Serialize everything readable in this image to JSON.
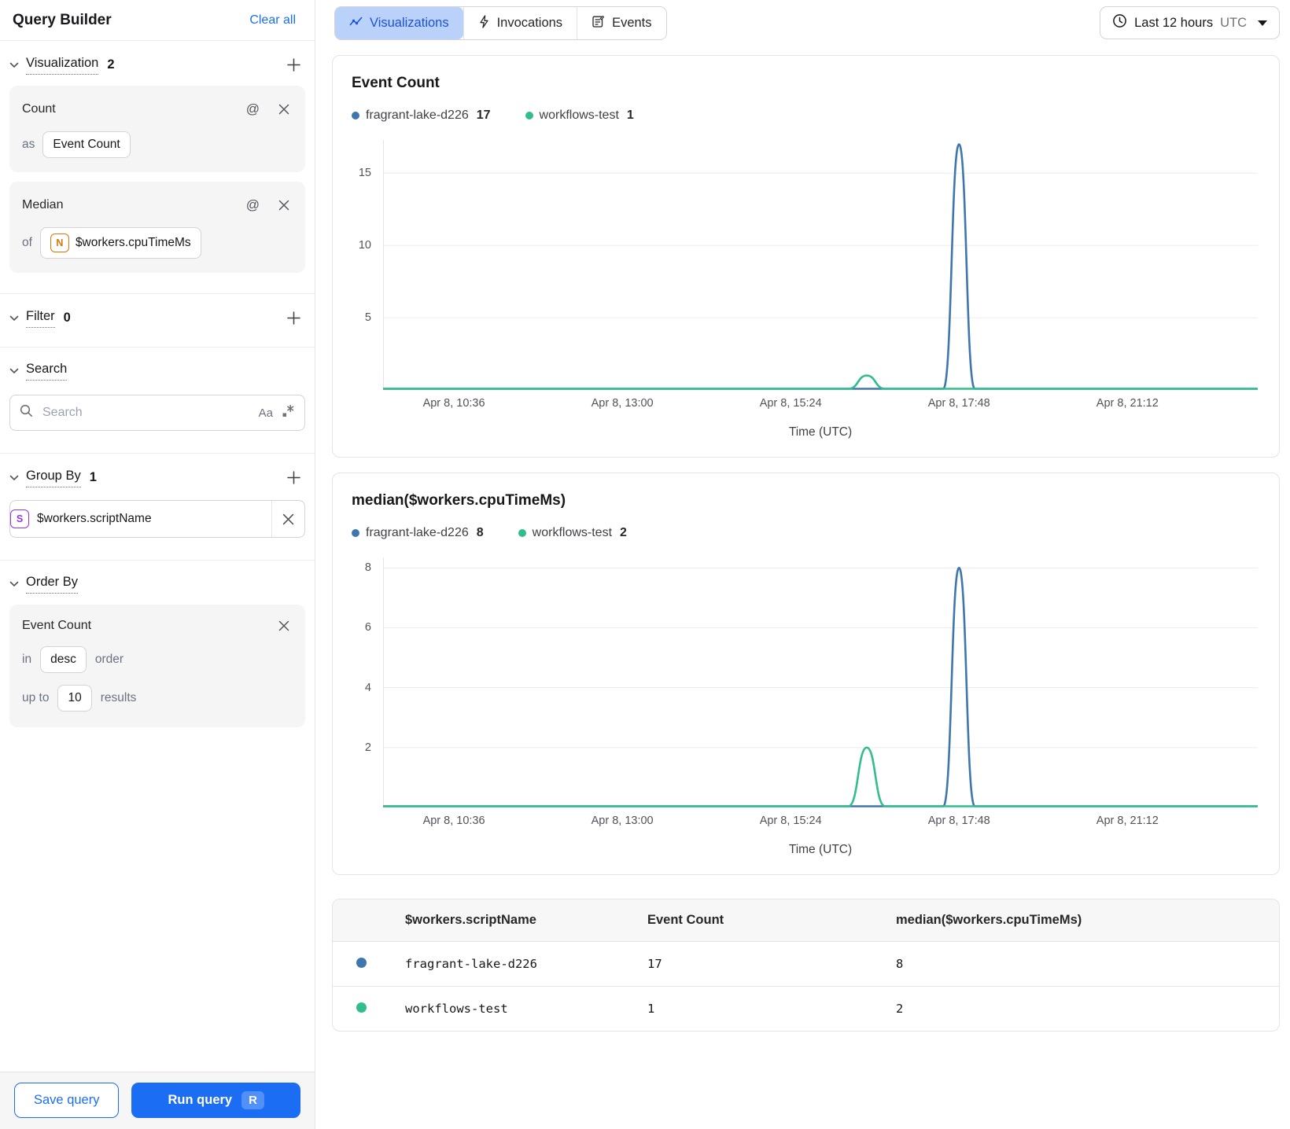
{
  "sidebar": {
    "title": "Query Builder",
    "clear_all": "Clear all",
    "visualization": {
      "label": "Visualization",
      "count": "2",
      "cards": [
        {
          "title": "Count",
          "prep": "as",
          "value": "Event Count"
        },
        {
          "title": "Median",
          "prep": "of",
          "value": "$workers.cpuTimeMs",
          "value_type_icon": "number-badge"
        }
      ]
    },
    "filter": {
      "label": "Filter",
      "count": "0"
    },
    "search": {
      "label": "Search",
      "placeholder": "Search",
      "match_case": "Aa"
    },
    "group_by": {
      "label": "Group By",
      "count": "1",
      "value": "$workers.scriptName",
      "value_type_icon": "string-badge"
    },
    "order_by": {
      "label": "Order By",
      "field": "Event Count",
      "in_label": "in",
      "direction": "desc",
      "order_label": "order",
      "up_to_label": "up to",
      "limit": "10",
      "results_label": "results"
    },
    "save_button": "Save query",
    "run_button": "Run query",
    "run_shortcut": "R"
  },
  "topbar": {
    "tabs": [
      {
        "label": "Visualizations",
        "active": true
      },
      {
        "label": "Invocations",
        "active": false
      },
      {
        "label": "Events",
        "active": false
      }
    ],
    "time_range": {
      "label": "Last 12 hours",
      "timezone": "UTC"
    }
  },
  "chart_data": [
    {
      "type": "line",
      "title": "Event Count",
      "xlabel": "Time (UTC)",
      "x_tick_labels": [
        "Apr 8, 10:36",
        "Apr 8, 13:00",
        "Apr 8, 15:24",
        "Apr 8, 17:48",
        "Apr 8, 21:12"
      ],
      "x_tick_positions": [
        0.081,
        0.2735,
        0.466,
        0.6585,
        0.851
      ],
      "y_ticks": [
        5,
        10,
        15
      ],
      "ylim": [
        0,
        17.3
      ],
      "grid": true,
      "legend_position": "top",
      "series": [
        {
          "name": "fragrant-lake-d226",
          "total": 17,
          "color": "#3e76ae",
          "baseline": 0,
          "peaks": [
            {
              "x": 0.6585,
              "time": "Apr 8, 17:48",
              "value": 17,
              "half_width": 0.018
            }
          ]
        },
        {
          "name": "workflows-test",
          "total": 1,
          "color": "#31bd8d",
          "baseline": 0,
          "peaks": [
            {
              "x": 0.553,
              "time": "Apr 8, 16:30",
              "value": 1,
              "half_width": 0.021
            }
          ]
        }
      ]
    },
    {
      "type": "line",
      "title": "median($workers.cpuTimeMs)",
      "xlabel": "Time (UTC)",
      "x_tick_labels": [
        "Apr 8, 10:36",
        "Apr 8, 13:00",
        "Apr 8, 15:24",
        "Apr 8, 17:48",
        "Apr 8, 21:12"
      ],
      "x_tick_positions": [
        0.081,
        0.2735,
        0.466,
        0.6585,
        0.851
      ],
      "y_ticks": [
        2,
        4,
        6,
        8
      ],
      "ylim": [
        0,
        8.35
      ],
      "grid": true,
      "legend_position": "top",
      "series": [
        {
          "name": "fragrant-lake-d226",
          "total": 8,
          "color": "#3e76ae",
          "baseline": 0,
          "peaks": [
            {
              "x": 0.6585,
              "time": "Apr 8, 17:48",
              "value": 8,
              "half_width": 0.018
            }
          ]
        },
        {
          "name": "workflows-test",
          "total": 2,
          "color": "#31bd8d",
          "baseline": 0,
          "peaks": [
            {
              "x": 0.553,
              "time": "Apr 8, 16:30",
              "value": 2,
              "half_width": 0.021
            }
          ]
        }
      ]
    }
  ],
  "table": {
    "columns": [
      "$workers.scriptName",
      "Event Count",
      "median($workers.cpuTimeMs)"
    ],
    "rows": [
      {
        "dot_color": "#3e76ae",
        "script": "fragrant-lake-d226",
        "event_count": "17",
        "median": "8"
      },
      {
        "dot_color": "#31bd8d",
        "script": "workflows-test",
        "event_count": "1",
        "median": "2"
      }
    ]
  }
}
